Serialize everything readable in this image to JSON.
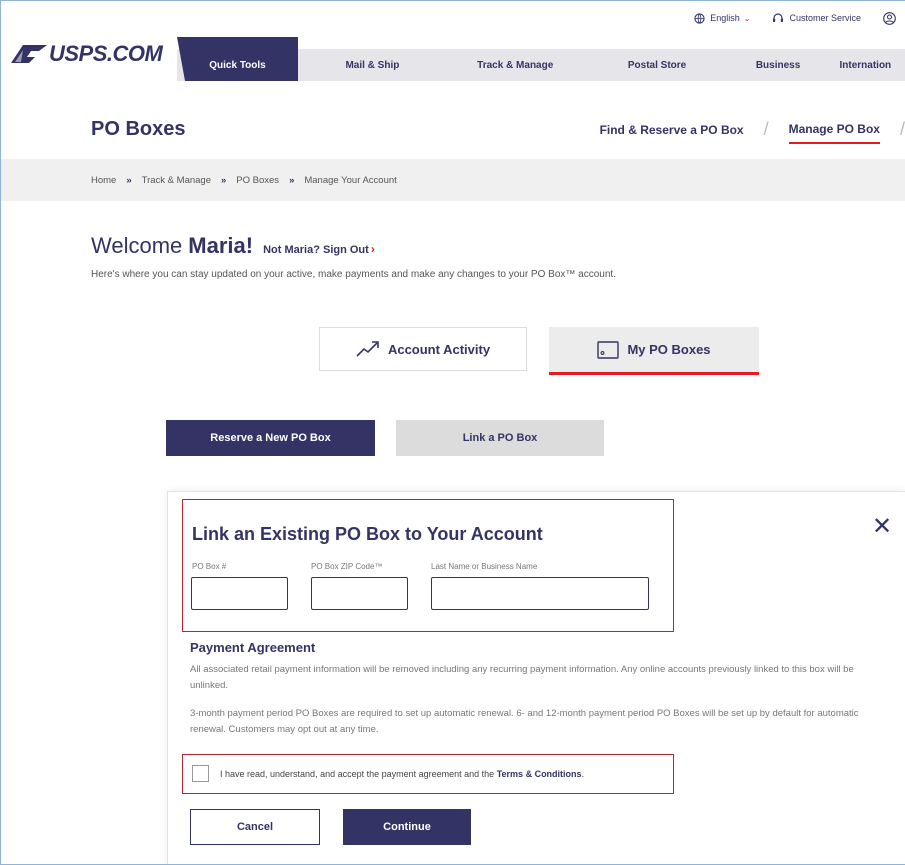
{
  "utility": {
    "language": "English",
    "customer_service": "Customer Service"
  },
  "logo": {
    "text": "USPS.COM"
  },
  "nav": {
    "items": [
      {
        "label": "Quick Tools"
      },
      {
        "label": "Mail & Ship"
      },
      {
        "label": "Track & Manage"
      },
      {
        "label": "Postal Store"
      },
      {
        "label": "Business"
      },
      {
        "label": "Internation"
      }
    ]
  },
  "header": {
    "title": "PO Boxes",
    "links": [
      {
        "label": "Find & Reserve a PO Box"
      },
      {
        "label": "Manage PO Box"
      }
    ]
  },
  "breadcrumb": [
    "Home",
    "Track & Manage",
    "PO Boxes",
    "Manage Your Account"
  ],
  "welcome": {
    "greeting": "Welcome",
    "name": "Maria!",
    "not_you": "Not Maria? Sign Out",
    "intro": "Here's where you can stay updated on your active, make payments and make any changes to your PO Box™ account."
  },
  "tabs": [
    {
      "label": "Account Activity"
    },
    {
      "label": "My PO Boxes"
    }
  ],
  "actions": {
    "reserve": "Reserve a New PO Box",
    "link": "Link a PO Box"
  },
  "modal": {
    "title": "Link an Existing PO Box to Your Account",
    "fields": [
      {
        "label": "PO Box #",
        "value": ""
      },
      {
        "label": "PO Box ZIP Code™",
        "value": ""
      },
      {
        "label": "Last Name or Business Name",
        "value": ""
      }
    ],
    "payment_title": "Payment Agreement",
    "payment_p1": "All associated retail payment information will be removed including any recurring payment information. Any online accounts previously linked to this box will be unlinked.",
    "payment_p2": "3-month payment period PO Boxes are required to set up automatic renewal. 6- and 12-month payment period PO Boxes will be set up by default for automatic renewal. Customers may opt out at any time.",
    "agree_text": "I have read, understand, and accept the payment agreement and the",
    "terms_link": "Terms & Conditions",
    "agree_end": ".",
    "agree_checked": false,
    "cancel": "Cancel",
    "continue": "Continue"
  },
  "colors": {
    "brand_navy": "#333366",
    "accent_red": "#e71921",
    "highlight_box": "#b5272e"
  }
}
